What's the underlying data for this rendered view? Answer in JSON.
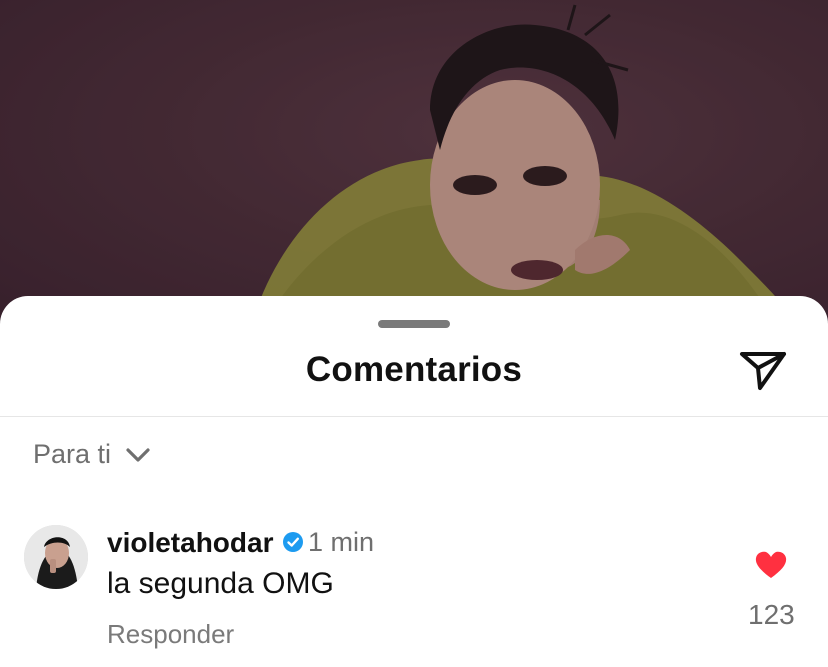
{
  "sheet": {
    "title": "Comentarios",
    "send_icon": "paper-plane-icon"
  },
  "filter": {
    "label": "Para ti",
    "icon": "chevron-down-icon"
  },
  "comment": {
    "username": "violetahodar",
    "verified_icon": "verified-badge-icon",
    "time": "1 min",
    "text": "la segunda OMG",
    "reply_label": "Responder",
    "likes": "123",
    "heart_icon": "heart-icon",
    "heart_color": "#ff3040"
  },
  "colors": {
    "background_photo": "#4b2f3a",
    "sheet": "#ffffff",
    "text_primary": "#111111",
    "text_secondary": "#6f6f6f",
    "verified": "#1d9bf0"
  }
}
